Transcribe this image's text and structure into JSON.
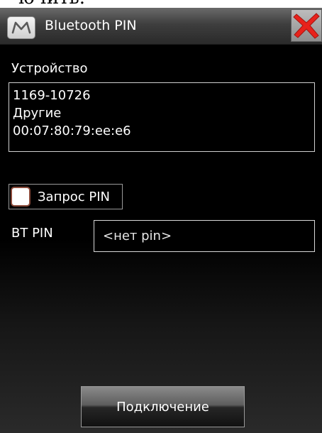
{
  "caption": {
    "clipped_text": "ючить."
  },
  "window": {
    "title": "Bluetooth PIN",
    "app_icon": "m-logo-icon",
    "close_icon": "close-x-icon",
    "close_color": "#e8221b"
  },
  "device": {
    "label": "Устройство",
    "lines": [
      "1169-10726",
      "Другие",
      "00:07:80:79:ee:e6"
    ]
  },
  "pin_request": {
    "label": "Запрос PIN",
    "checked": false
  },
  "bt_pin": {
    "label": "BT PIN",
    "placeholder": "<нет pin>",
    "value": ""
  },
  "actions": {
    "connect_label": "Подключение"
  }
}
